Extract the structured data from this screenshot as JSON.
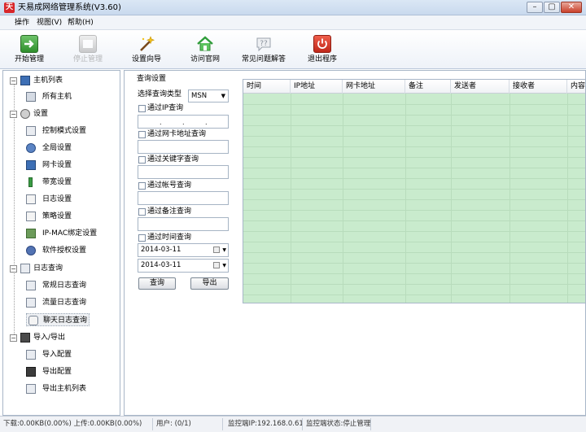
{
  "window": {
    "title": "天易成网络管理系统(V3.60)",
    "logo_text": "天",
    "minimize_label": "–",
    "maximize_label": "▢",
    "close_label": "✕"
  },
  "menu": [
    {
      "label": "操作"
    },
    {
      "label": "视图(V)"
    },
    {
      "label": "帮助(H)"
    }
  ],
  "toolbar": {
    "start": "开始管理",
    "stop": "停止管理",
    "wizard": "设置向导",
    "website": "访问官网",
    "faq": "常见问题解答",
    "exit": "退出程序"
  },
  "sidebar": {
    "host_list": "主机列表",
    "all_hosts": "所有主机",
    "settings": "设置",
    "control_mode": "控制模式设置",
    "global": "全局设置",
    "nic": "网卡设置",
    "bandwidth": "带宽设置",
    "log_settings": "日志设置",
    "policy": "策略设置",
    "ipmac": "IP-MAC绑定设置",
    "license": "软件授权设置",
    "log_query": "日志查询",
    "normal_log": "常规日志查询",
    "traffic_log": "流量日志查询",
    "chat_log": "聊天日志查询",
    "import_export": "导入/导出",
    "import_config": "导入配置",
    "export_config": "导出配置",
    "export_hosts": "导出主机列表"
  },
  "query": {
    "title": "查询设置",
    "type_label": "选择查询类型",
    "type_value": "MSN",
    "by_ip": "通过IP查询",
    "by_mac": "通过网卡地址查询",
    "by_keyword": "通过关键字查询",
    "by_account": "通过帐号查询",
    "by_note": "通过备注查询",
    "by_time": "通过时间查询",
    "date_from": "2014-03-11",
    "date_to": "2014-03-11",
    "query_button": "查询",
    "export_button": "导出"
  },
  "table": {
    "columns": [
      "时间",
      "IP地址",
      "网卡地址",
      "备注",
      "发送者",
      "接收者",
      "内容"
    ]
  },
  "status": {
    "traffic": "下载:0.00KB(0.00%) 上传:0.00KB(0.00%)",
    "users": "用户: (0/1)",
    "monitor_ip": "监控端IP:192.168.0.61",
    "monitor_state": "监控端状态:停止管理"
  },
  "colors": {
    "table_bg": "#c9ebcd",
    "accent": "#d8262a"
  }
}
